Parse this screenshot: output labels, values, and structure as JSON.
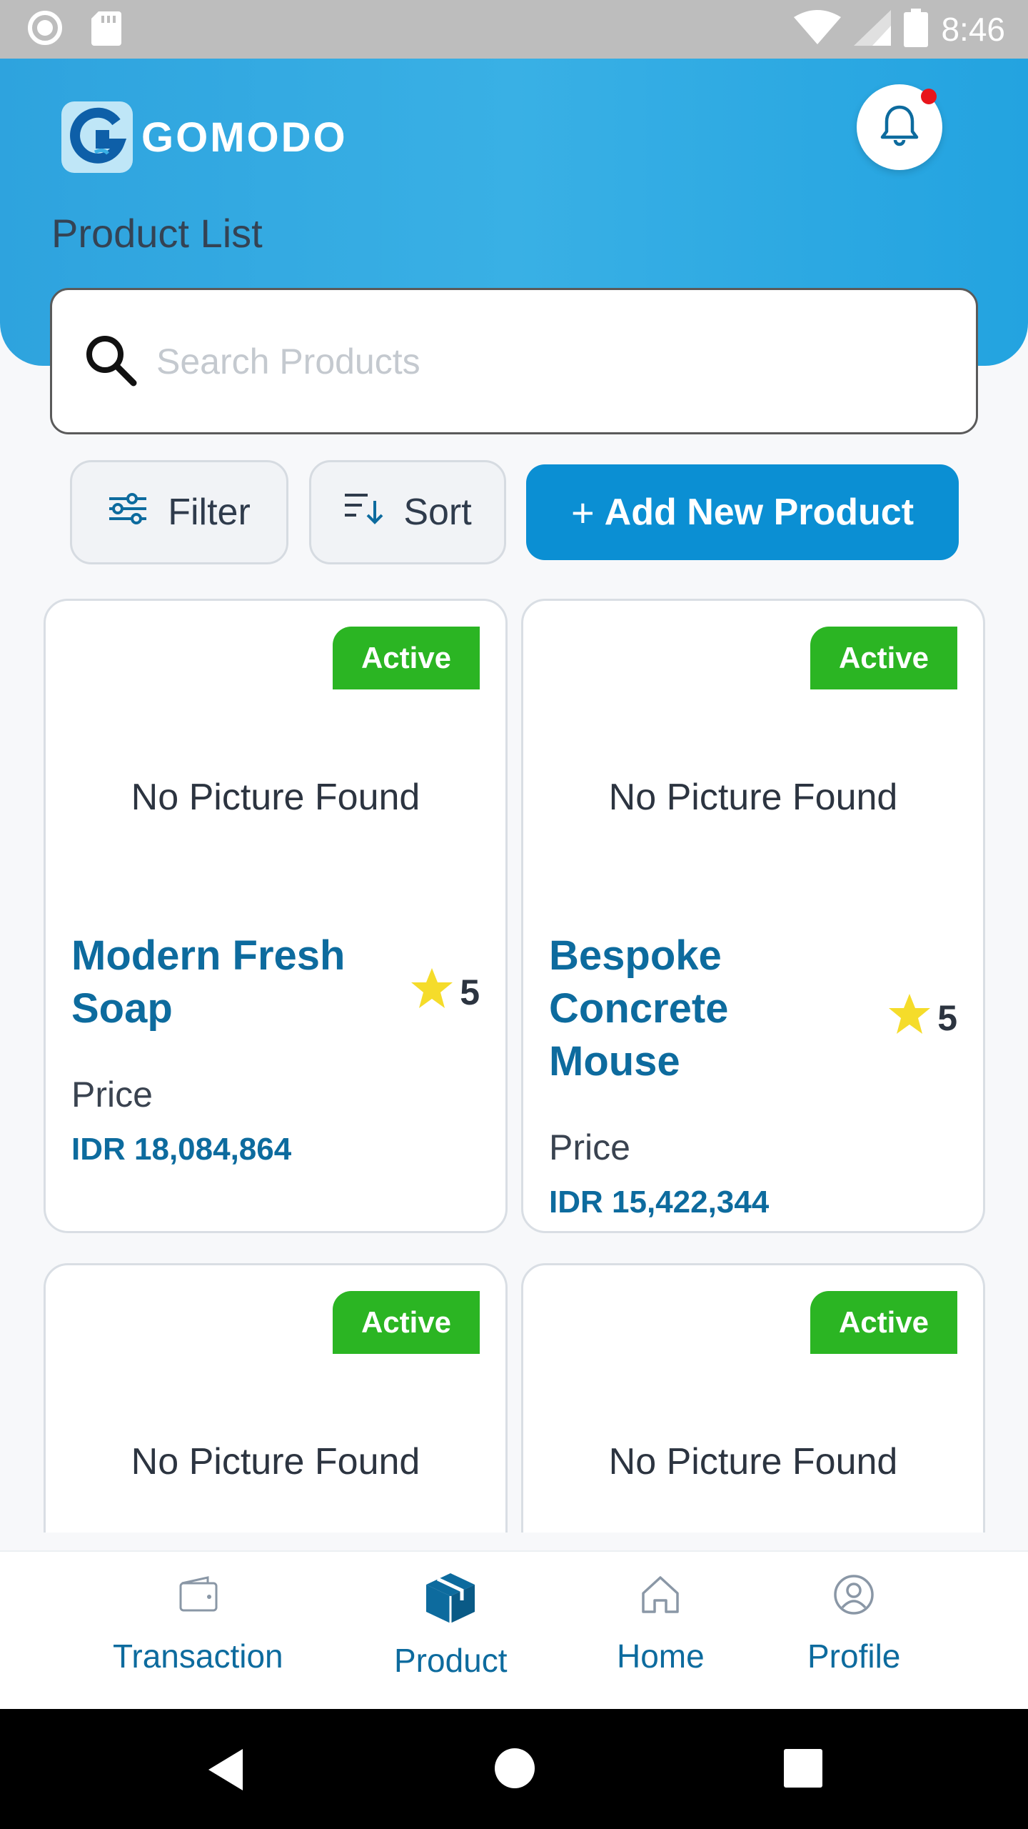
{
  "status_bar": {
    "time": "8:46",
    "left_icons": [
      "record-icon",
      "sd-card-icon"
    ],
    "right_icons": [
      "wifi-icon",
      "signal-icon",
      "battery-icon"
    ]
  },
  "header": {
    "logo_text": "GOMODO",
    "page_title": "Product List",
    "notification_dot_color": "#e8141b"
  },
  "search": {
    "placeholder": "Search Products",
    "value": ""
  },
  "actions": {
    "filter_label": "Filter",
    "sort_label": "Sort",
    "add_label": "Add New Product",
    "add_prefix": "+"
  },
  "products": [
    {
      "status": "Active",
      "picture_text": "No Picture Found",
      "name": "Modern Fresh Soap",
      "rating": "5",
      "price_label": "Price",
      "price": "IDR 18,084,864"
    },
    {
      "status": "Active",
      "picture_text": "No Picture Found",
      "name": "Bespoke Concrete Mouse",
      "rating": "5",
      "price_label": "Price",
      "price": "IDR 15,422,344"
    },
    {
      "status": "Active",
      "picture_text": "No Picture Found"
    },
    {
      "status": "Active",
      "picture_text": "No Picture Found"
    }
  ],
  "bottom_nav": [
    {
      "label": "Transaction",
      "icon": "wallet-icon",
      "active": false
    },
    {
      "label": "Product",
      "icon": "box-icon",
      "active": true
    },
    {
      "label": "Home",
      "icon": "home-icon",
      "active": false
    },
    {
      "label": "Profile",
      "icon": "profile-icon",
      "active": false
    }
  ],
  "colors": {
    "header_blue": "#2ea3de",
    "brand_blue": "#0b8fd3",
    "text_blue": "#0d6b9e",
    "active_green": "#2bb523",
    "star_yellow": "#f5dc2a"
  }
}
